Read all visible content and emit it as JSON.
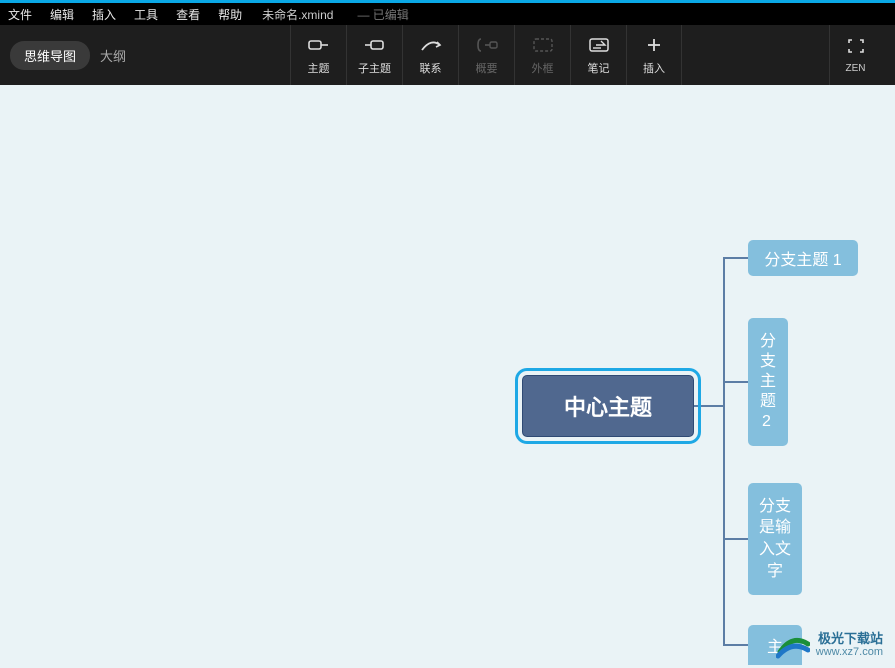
{
  "menu": {
    "file": "文件",
    "edit": "编辑",
    "insert": "插入",
    "tool": "工具",
    "view": "查看",
    "help": "帮助",
    "filename": "未命名.xmind",
    "status": "— 已编辑"
  },
  "view_tabs": {
    "mindmap": "思维导图",
    "outline": "大纲"
  },
  "tools": {
    "topic": "主题",
    "subtopic": "子主题",
    "relation": "联系",
    "summary": "概要",
    "boundary": "外框",
    "note": "笔记",
    "insert": "插入",
    "zen": "ZEN"
  },
  "mindmap": {
    "center": "中心主题",
    "branch1": "分支主题 1",
    "branch2": "分支主题2",
    "branch3": "分支是输入文字",
    "branch4": "主"
  },
  "watermark": {
    "line1": "极光下载站",
    "line2": "www.xz7.com"
  },
  "colors": {
    "accent": "#0aa8e6",
    "canvas": "#eaf3f6",
    "center_node": "#50688f",
    "branch_node": "#84bfdd",
    "connector": "#5c7da5"
  }
}
